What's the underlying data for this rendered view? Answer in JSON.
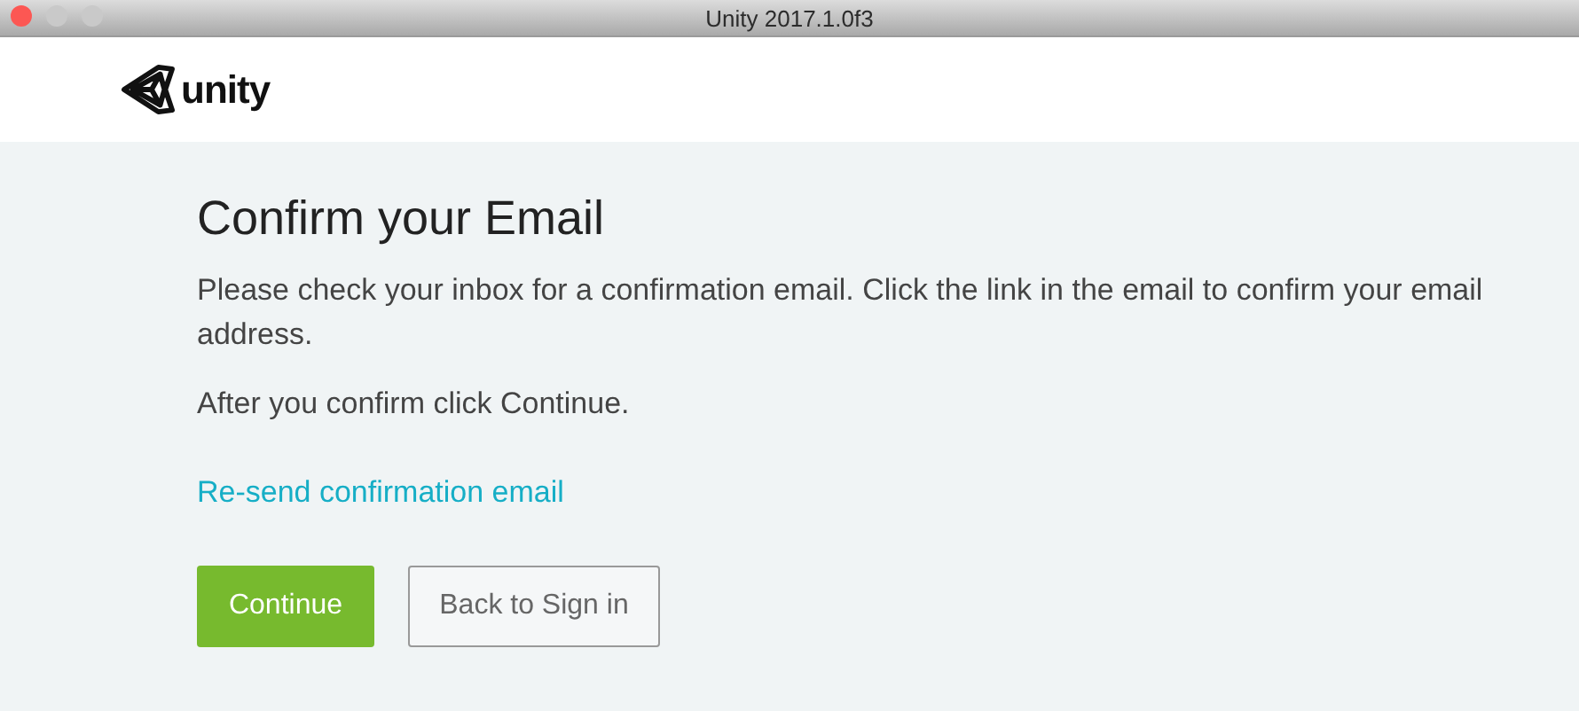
{
  "window": {
    "title": "Unity 2017.1.0f3",
    "controls": [
      {
        "kind": "close"
      },
      {
        "kind": "minimize"
      },
      {
        "kind": "zoom"
      }
    ]
  },
  "header": {
    "logo_text": "unity"
  },
  "content": {
    "heading": "Confirm your Email",
    "paragraphs": [
      "Please check your inbox for a confirmation email. Click the link in the email to confirm your email address.",
      "After you confirm click Continue."
    ],
    "link": "Re-send confirmation email",
    "buttons": [
      {
        "label": "Continue",
        "kind": "primary"
      },
      {
        "label": "Back to Sign in",
        "kind": "secondary"
      }
    ]
  }
}
